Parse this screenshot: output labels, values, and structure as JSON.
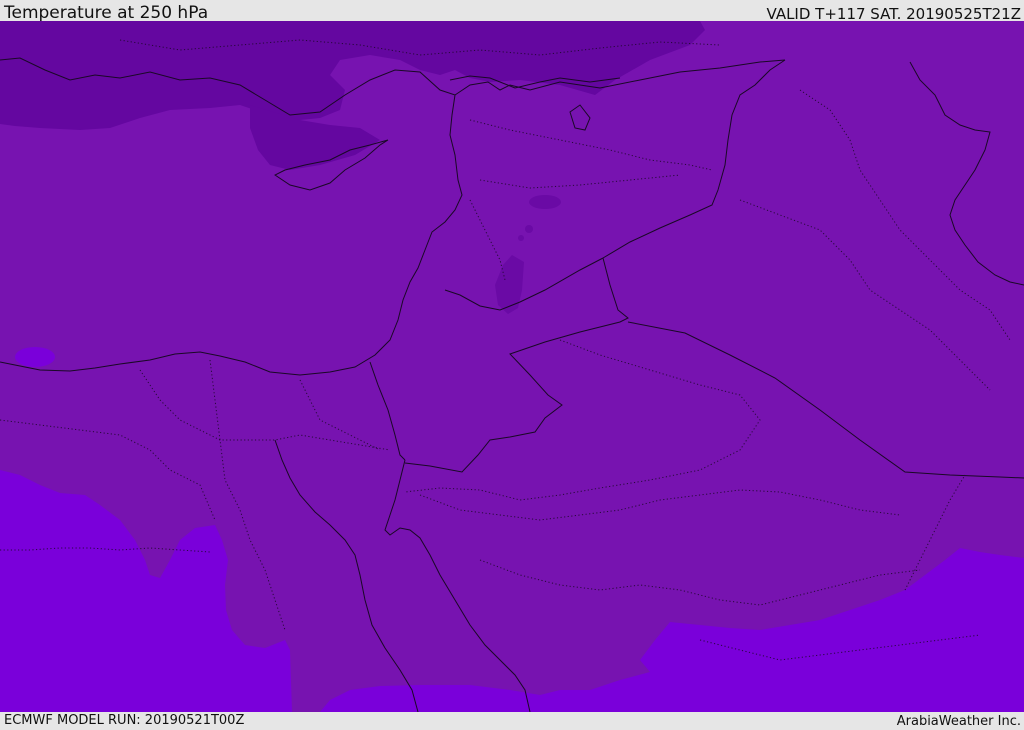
{
  "header": {
    "title": "Temperature at 250 hPa",
    "valid": "VALID T+117 SAT. 20190525T21Z"
  },
  "footer": {
    "model_run": "ECMWF MODEL RUN: 20190521T00Z",
    "credit": "ArabiaWeather Inc."
  },
  "colors": {
    "base": "#7713b0",
    "cold_north": "#6407a0",
    "cold_pockets": "#6a0aa5",
    "warm_south": "#7a00da",
    "line_color": "#1a0826",
    "bar_background": "#e6e6e6"
  }
}
